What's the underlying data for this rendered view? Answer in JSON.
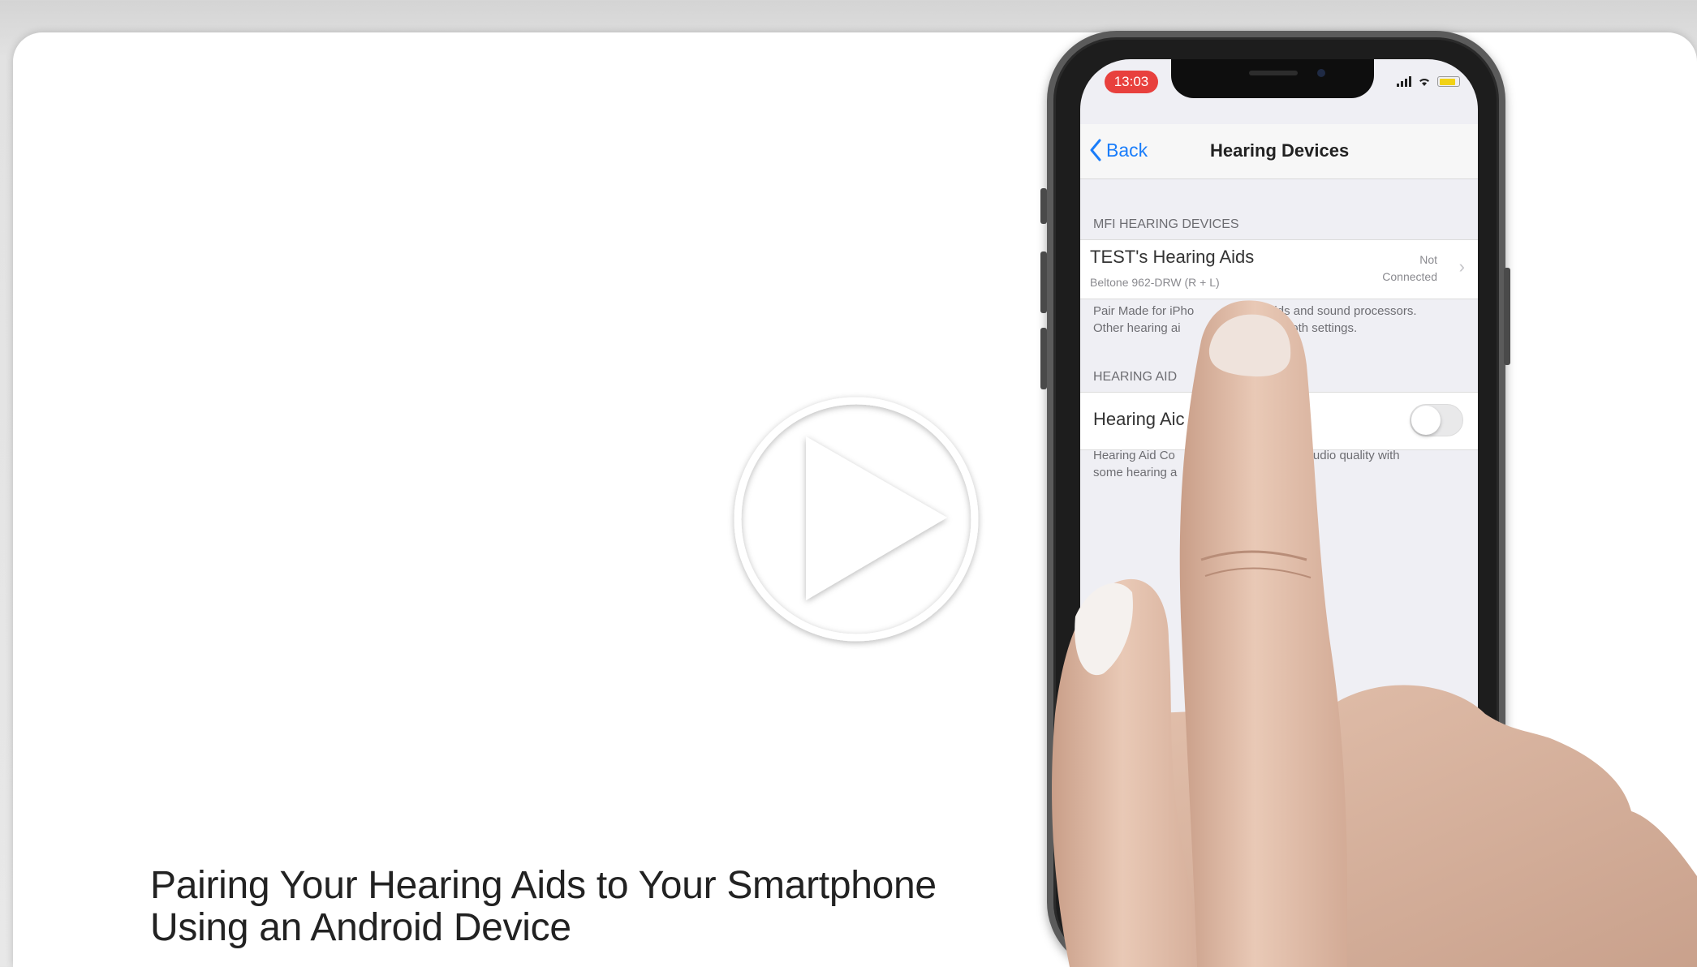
{
  "video": {
    "title_line1": "Pairing Your Hearing Aids to Your Smartphone",
    "title_line2": "Using an Android Device"
  },
  "phone": {
    "status_time": "13:03",
    "nav": {
      "back_label": "Back",
      "title": "Hearing Devices"
    },
    "mfi_section": {
      "header": "MFI HEARING DEVICES",
      "device_name": "TEST's Hearing Aids",
      "device_model": "Beltone 962-DRW (R + L)",
      "status_line1": "Not",
      "status_line2": "Connected",
      "footer_line1": "Pair Made for iPho",
      "footer_line1b": "ng aids and sound processors.",
      "footer_line2": "Other hearing ai",
      "footer_line2b": "t in Bluetooth settings."
    },
    "hearing_aid_section": {
      "header": "HEARING AID",
      "row_label": "Hearing Aic",
      "toggle_on": false,
      "footer_line1": "Hearing Aid Co",
      "footer_line1b": "s audio quality with",
      "footer_line2": "some hearing a"
    }
  },
  "icons": {
    "play": "play-icon",
    "back": "chevron-left-icon",
    "disclosure": "chevron-right-icon"
  },
  "colors": {
    "ios_blue": "#1a7dfa",
    "recording_pill": "#e8403d",
    "skin": "#e6c2ae"
  }
}
